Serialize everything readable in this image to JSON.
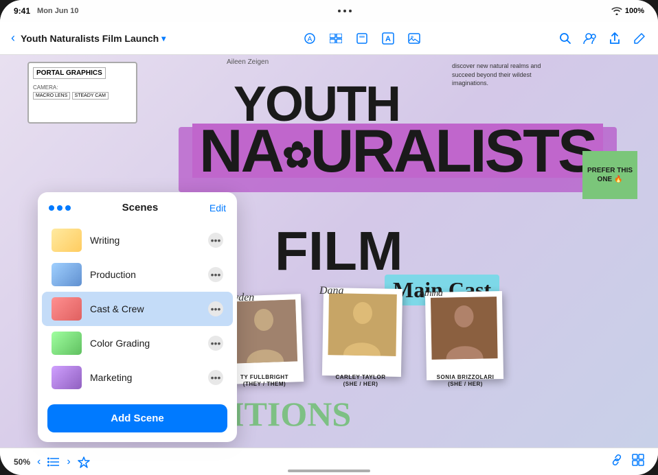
{
  "statusBar": {
    "time": "9:41",
    "day": "Mon Jun 10",
    "wifiIcon": "wifi",
    "batteryLevel": "100%"
  },
  "toolbar": {
    "backLabel": "‹",
    "title": "Youth Naturalists Film Launch",
    "titleChevron": "▾",
    "icons": [
      "circle-icon",
      "window-icon",
      "grid-icon",
      "text-icon",
      "photo-icon"
    ],
    "rightIcons": [
      "search-icon",
      "person-icon",
      "share-icon",
      "edit-icon"
    ]
  },
  "canvas": {
    "titleYouth": "YOUTH",
    "titleNaturalists": "NAtURALISTS",
    "titleFilm": "FILM",
    "mainCastLabel": "Main Cast",
    "annotationName": "Aileen Zeigen",
    "annotationText": "discover new natural realms and succeed beyond their wildest imaginations.",
    "stickyNote": "PREFER THIS ONE 🔥",
    "auditionsText": "DITIONS",
    "cast": [
      {
        "scriptName": "Jayden",
        "fullName": "TY FULLBRIGHT",
        "pronoun": "(THEY / THEM)"
      },
      {
        "scriptName": "Dana",
        "fullName": "CARLEY TAYLOR",
        "pronoun": "(SHE / HER)"
      },
      {
        "scriptName": "Athina",
        "fullName": "SONIA BRIZZOLARI",
        "pronoun": "(SHE / HER)"
      }
    ]
  },
  "scenesPanel": {
    "title": "Scenes",
    "editLabel": "Edit",
    "addSceneLabel": "Add Scene",
    "scenes": [
      {
        "id": "writing",
        "name": "Writing",
        "thumbClass": "thumb-writing",
        "active": false
      },
      {
        "id": "production",
        "name": "Production",
        "thumbClass": "thumb-production",
        "active": false
      },
      {
        "id": "cast-crew",
        "name": "Cast & Crew",
        "thumbClass": "thumb-castcrew",
        "active": true
      },
      {
        "id": "color-grading",
        "name": "Color Grading",
        "thumbClass": "thumb-colorgrading",
        "active": false
      },
      {
        "id": "marketing",
        "name": "Marketing",
        "thumbClass": "thumb-marketing",
        "active": false
      }
    ]
  },
  "bottomBar": {
    "zoomLevel": "50%",
    "prevLabel": "‹",
    "nextLabel": "›"
  }
}
